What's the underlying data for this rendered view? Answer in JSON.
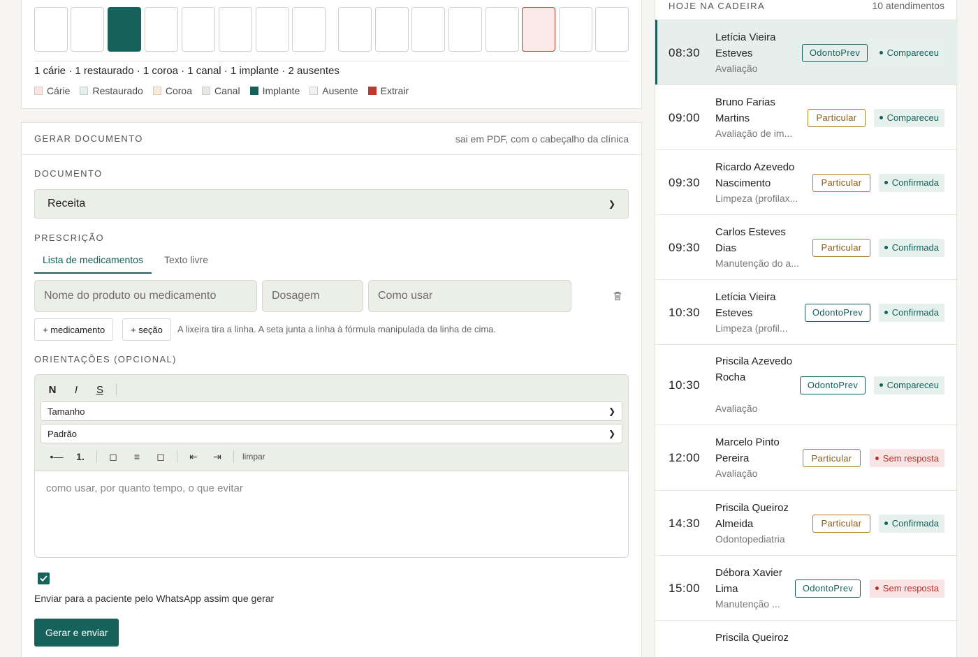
{
  "odontogram": {
    "summary": "1 cárie · 1 restaurado · 1 coroa · 1 canal · 1 implante · 2 ausentes",
    "legend": [
      {
        "label": "Cárie",
        "color": "#fbe3e0"
      },
      {
        "label": "Restaurado",
        "color": "#e4efee"
      },
      {
        "label": "Coroa",
        "color": "#f8ecd6"
      },
      {
        "label": "Canal",
        "color": "#e8e8e4"
      },
      {
        "label": "Implante",
        "color": "#16625a"
      },
      {
        "label": "Ausente",
        "color": "#f2f2ef"
      },
      {
        "label": "Extrair",
        "color": "#c0382f"
      }
    ]
  },
  "document": {
    "header": "GERAR DOCUMENTO",
    "header_note": "sai em PDF, com o cabeçalho da clínica",
    "doc_label": "DOCUMENTO",
    "doc_type": "Receita",
    "prescricao_label": "PRESCRIÇÃO",
    "tabs": [
      "Lista de medicamentos",
      "Texto livre"
    ],
    "med_placeholder": "Nome do produto ou medicamento",
    "dose_placeholder": "Dosagem",
    "usage_placeholder": "Como usar",
    "add_med": "+ medicamento",
    "add_section": "+ seção",
    "hint": "A lixeira tira a linha. A seta junta a linha à fórmula manipulada da linha de cima.",
    "orient_label": "ORIENTAÇÕES (OPCIONAL)",
    "toolbar": {
      "bold": "N",
      "italic": "I",
      "strike": "S",
      "size": "Tamanho",
      "font": "Padrão",
      "bullet": "•—",
      "ordered": "1.",
      "clear": "limpar"
    },
    "editor_placeholder": "como usar, por quanto tempo, o que evitar",
    "whatsapp_label": "Enviar para a paciente pelo WhatsApp assim que gerar",
    "submit": "Gerar e enviar"
  },
  "agenda": {
    "title": "HOJE NA CADEIRA",
    "count": "10 atendimentos",
    "items": [
      {
        "time": "08:30",
        "name": "Letícia Vieira Esteves",
        "proc": "Avaliação",
        "plan": "OdontoPrev",
        "status": "Compareceu"
      },
      {
        "time": "09:00",
        "name": "Bruno Farias Martins",
        "proc": "Avaliação de im...",
        "plan": "Particular",
        "status": "Compareceu"
      },
      {
        "time": "09:30",
        "name": "Ricardo Azevedo Nascimento",
        "proc": "Limpeza (profilax...",
        "plan": "Particular",
        "status": "Confirmada"
      },
      {
        "time": "09:30",
        "name": "Carlos Esteves Dias",
        "proc": "Manutenção do a...",
        "plan": "Particular",
        "status": "Confirmada"
      },
      {
        "time": "10:30",
        "name": "Letícia Vieira Esteves",
        "proc": "Limpeza (profil...",
        "plan": "OdontoPrev",
        "status": "Confirmada"
      },
      {
        "time": "10:30",
        "name": "Priscila Azevedo Rocha",
        "proc": "Avaliação",
        "plan": "OdontoPrev",
        "status": "Compareceu"
      },
      {
        "time": "12:00",
        "name": "Marcelo Pinto Pereira",
        "proc": "Avaliação",
        "plan": "Particular",
        "status": "Sem resposta"
      },
      {
        "time": "14:30",
        "name": "Priscila Queiroz Almeida",
        "proc": "Odontopediatria",
        "plan": "Particular",
        "status": "Confirmada"
      },
      {
        "time": "15:00",
        "name": "Débora Xavier Lima",
        "proc": "Manutenção ...",
        "plan": "OdontoPrev",
        "status": "Sem resposta"
      },
      {
        "time": "",
        "name": "Priscila Queiroz",
        "proc": "",
        "plan": "",
        "status": ""
      }
    ]
  }
}
